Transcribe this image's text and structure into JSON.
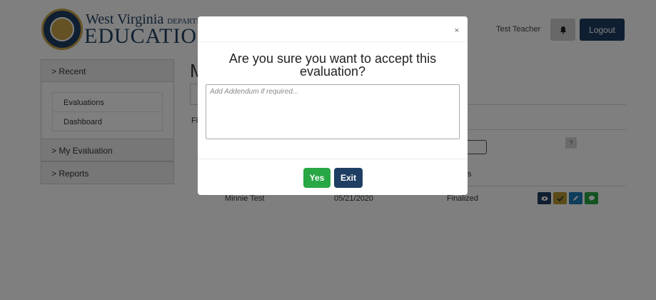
{
  "header": {
    "logo_line1": "West Virginia",
    "logo_dept": "DEPARTMENT",
    "logo_line2": "EDUCATIO",
    "user_name": "Test Teacher",
    "logout_label": "Logout",
    "icons": {
      "bell": "bell-icon"
    }
  },
  "sidebar": {
    "sections": [
      {
        "label": "> Recent",
        "items": [
          "Evaluations",
          "Dashboard"
        ]
      },
      {
        "label": "> My Evaluation"
      },
      {
        "label": "> Reports"
      }
    ]
  },
  "main": {
    "title_partial": "M",
    "filter_label_partial": "Fi",
    "help_label": "?",
    "column_partial": "s",
    "rows": [
      {
        "name": "Minnie Test",
        "date": "05/21/2020",
        "status": "Finalized",
        "actions": [
          {
            "icon": "eye-icon",
            "color": "#1f3e63"
          },
          {
            "icon": "check-icon",
            "color": "#b8962e"
          },
          {
            "icon": "pencil-icon",
            "color": "#1f7ab8"
          },
          {
            "icon": "comment-icon",
            "color": "#28a745"
          }
        ]
      }
    ]
  },
  "modal": {
    "close_label": "×",
    "title": "Are you sure you want to accept this evaluation?",
    "textarea_placeholder": "Add Addendum if required...",
    "yes_label": "Yes",
    "exit_label": "Exit"
  },
  "colors": {
    "primary": "#1f3e63",
    "success": "#28a745",
    "overlay": "rgba(0,0,0,0.5)"
  }
}
